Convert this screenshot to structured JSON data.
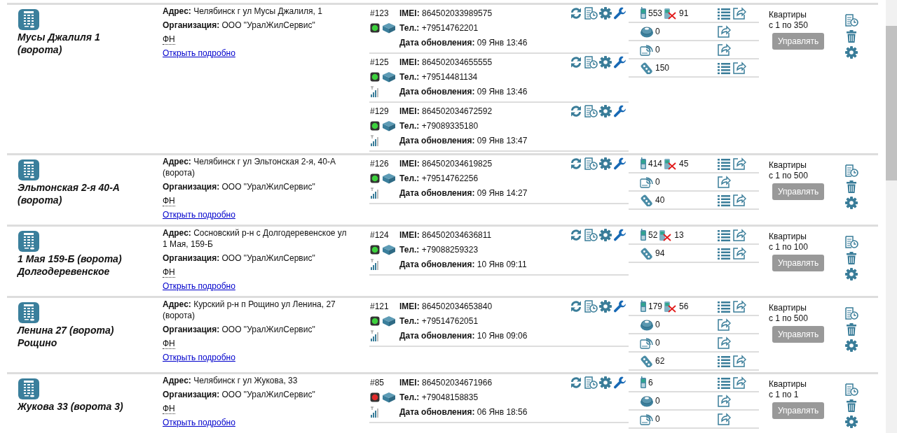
{
  "objects": [
    {
      "title": "Мусы Джалиля 1 (ворота)",
      "address_label": "Адрес:",
      "address": "Челябинск г ул Мусы Джалиля, 1",
      "org_label": "Организация:",
      "organization": "ООО \"УралЖилСервис\"",
      "fn": "ФН",
      "link": "Открыть подробно",
      "controllers": [
        {
          "number": "#123",
          "imei_label": "IMEI:",
          "imei": "864502033989575",
          "phone_label": "Тел.:",
          "phone": "+79514762201",
          "date_label": "Дата обновления:",
          "date": "09 Янв 13:46",
          "online": true,
          "signal": false
        },
        {
          "number": "#125",
          "imei_label": "IMEI:",
          "imei": "864502034655555",
          "phone_label": "Тел.:",
          "phone": "+79514481134",
          "date_label": "Дата обновления:",
          "date": "09 Янв 13:46",
          "online": true,
          "signal": true
        },
        {
          "number": "#129",
          "imei_label": "IMEI:",
          "imei": "864502034672592",
          "phone_label": "Тел.:",
          "phone": "+79089335180",
          "date_label": "Дата обновления:",
          "date": "09 Янв 13:47",
          "online": true,
          "signal": true
        }
      ],
      "counters": [
        {
          "kind": "phone",
          "value": "553",
          "blocked": "91"
        },
        {
          "kind": "key",
          "value": "0"
        },
        {
          "kind": "rfid",
          "value": "0"
        },
        {
          "kind": "remote",
          "value": "150"
        }
      ],
      "apartments_label": "Квартиры",
      "apartments_range": "с 1 по 350",
      "manage_button": "Управлять"
    },
    {
      "title": "Эльтонская 2-я 40-А (ворота)",
      "address_label": "Адрес:",
      "address": "Челябинск г ул Эльтонская 2-я, 40-А (ворота)",
      "org_label": "Организация:",
      "organization": "ООО \"УралЖилСервис\"",
      "fn": "ФН",
      "link": "Открыть подробно",
      "controllers": [
        {
          "number": "#126",
          "imei_label": "IMEI:",
          "imei": "864502034619825",
          "phone_label": "Тел.:",
          "phone": "+79514762256",
          "date_label": "Дата обновления:",
          "date": "09 Янв 14:27",
          "online": true,
          "signal": true
        }
      ],
      "counters": [
        {
          "kind": "phone",
          "value": "414",
          "blocked": "45"
        },
        {
          "kind": "rfid",
          "value": "0"
        },
        {
          "kind": "remote",
          "value": "40"
        }
      ],
      "apartments_label": "Квартиры",
      "apartments_range": "с 1 по 500",
      "manage_button": "Управлять"
    },
    {
      "title": "1 Мая 159-Б (ворота) Долгодеревенское",
      "address_label": "Адрес:",
      "address": "Сосновский р-н с Долгодеревенское ул 1 Мая, 159-Б",
      "org_label": "Организация:",
      "organization": "ООО \"УралЖилСервис\"",
      "fn": "ФН",
      "link": "Открыть подробно",
      "controllers": [
        {
          "number": "#124",
          "imei_label": "IMEI:",
          "imei": "864502034636811",
          "phone_label": "Тел.:",
          "phone": "+79088259323",
          "date_label": "Дата обновления:",
          "date": "10 Янв 09:11",
          "online": true,
          "signal": true
        }
      ],
      "counters": [
        {
          "kind": "phone",
          "value": "52",
          "blocked": "13"
        },
        {
          "kind": "remote",
          "value": "94"
        }
      ],
      "apartments_label": "Квартиры",
      "apartments_range": "с 1 по 100",
      "manage_button": "Управлять"
    },
    {
      "title": "Ленина 27 (ворота) Рощино",
      "address_label": "Адрес:",
      "address": "Курский р-н п Рощино ул Ленина, 27 (ворота)",
      "org_label": "Организация:",
      "organization": "ООО \"УралЖилСервис\"",
      "fn": "ФН",
      "link": "Открыть подробно",
      "controllers": [
        {
          "number": "#121",
          "imei_label": "IMEI:",
          "imei": "864502034653840",
          "phone_label": "Тел.:",
          "phone": "+79514762051",
          "date_label": "Дата обновления:",
          "date": "10 Янв 09:06",
          "online": true,
          "signal": true
        }
      ],
      "counters": [
        {
          "kind": "phone",
          "value": "179",
          "blocked": "56"
        },
        {
          "kind": "key",
          "value": "0"
        },
        {
          "kind": "rfid",
          "value": "0"
        },
        {
          "kind": "remote",
          "value": "62"
        }
      ],
      "apartments_label": "Квартиры",
      "apartments_range": "с 1 по 500",
      "manage_button": "Управлять"
    },
    {
      "title": "Жукова 33 (ворота 3)",
      "address_label": "Адрес:",
      "address": "Челябинск г ул Жукова, 33",
      "org_label": "Организация:",
      "organization": "ООО \"УралЖилСервис\"",
      "fn": "ФН",
      "link": "Открыть подробно",
      "controllers": [
        {
          "number": "#85",
          "imei_label": "IMEI:",
          "imei": "864502034671966",
          "phone_label": "Тел.:",
          "phone": "+79048158835",
          "date_label": "Дата обновления:",
          "date": "06 Янв 18:56",
          "online": false,
          "signal": true
        }
      ],
      "counters": [
        {
          "kind": "phone",
          "value": "6"
        },
        {
          "kind": "key",
          "value": "0"
        },
        {
          "kind": "rfid",
          "value": "0"
        }
      ],
      "apartments_label": "Квартиры",
      "apartments_range": "с 1 по 1",
      "manage_button": "Управлять"
    }
  ]
}
